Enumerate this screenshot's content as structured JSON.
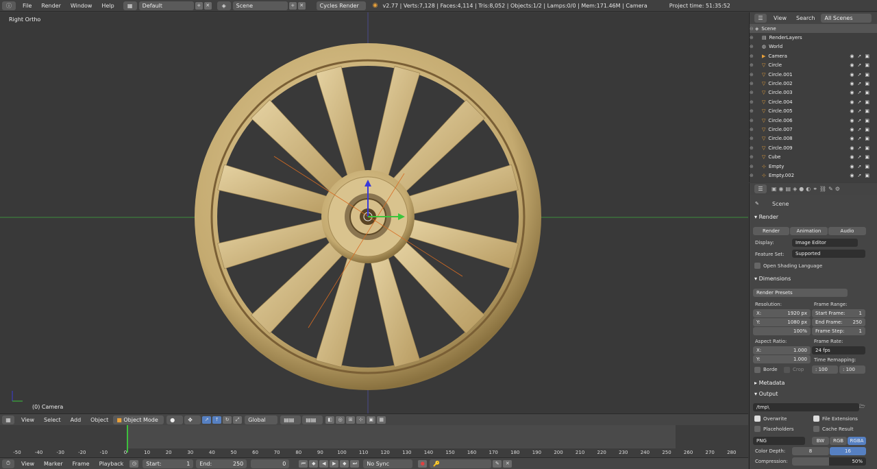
{
  "topbar": {
    "menus": [
      "File",
      "Render",
      "Window",
      "Help"
    ],
    "layout": "Default",
    "scene": "Scene",
    "engine": "Cycles Render",
    "stats": "v2.77 | Verts:7,128 | Faces:4,114 | Tris:8,052 | Objects:1/2 | Lamps:0/0 | Mem:171.46M | Camera",
    "project_time": "Project time: 51:35:52"
  },
  "viewport": {
    "view_name": "Right Ortho",
    "object_label": "(0) Camera"
  },
  "outliner": {
    "menus": [
      "View",
      "Search"
    ],
    "filter": "All Scenes",
    "items": [
      {
        "label": "Scene",
        "icon": "scene-icon",
        "indent": 0
      },
      {
        "label": "RenderLayers",
        "icon": "renderlayers-icon",
        "indent": 1
      },
      {
        "label": "World",
        "icon": "world-icon",
        "indent": 1
      },
      {
        "label": "Camera",
        "icon": "camera-icon",
        "indent": 1
      },
      {
        "label": "Circle",
        "icon": "mesh-icon",
        "indent": 1
      },
      {
        "label": "Circle.001",
        "icon": "mesh-icon",
        "indent": 1
      },
      {
        "label": "Circle.002",
        "icon": "mesh-icon",
        "indent": 1
      },
      {
        "label": "Circle.003",
        "icon": "mesh-icon",
        "indent": 1
      },
      {
        "label": "Circle.004",
        "icon": "mesh-icon",
        "indent": 1
      },
      {
        "label": "Circle.005",
        "icon": "mesh-icon",
        "indent": 1
      },
      {
        "label": "Circle.006",
        "icon": "mesh-icon",
        "indent": 1
      },
      {
        "label": "Circle.007",
        "icon": "mesh-icon",
        "indent": 1
      },
      {
        "label": "Circle.008",
        "icon": "mesh-icon",
        "indent": 1
      },
      {
        "label": "Circle.009",
        "icon": "mesh-icon",
        "indent": 1
      },
      {
        "label": "Cube",
        "icon": "mesh-icon",
        "indent": 1
      },
      {
        "label": "Empty",
        "icon": "empty-icon",
        "indent": 1
      },
      {
        "label": "Empty.002",
        "icon": "empty-icon",
        "indent": 1
      }
    ]
  },
  "props": {
    "context": "Scene",
    "render_panel": "Render",
    "tabs": [
      "Render",
      "Animation",
      "Audio"
    ],
    "display_label": "Display:",
    "display_value": "Image Editor",
    "feature_label": "Feature Set:",
    "feature_value": "Supported",
    "osl_label": "Open Shading Language",
    "dimensions_panel": "Dimensions",
    "render_presets": "Render Presets",
    "resolution_label": "Resolution:",
    "res_x_label": "X:",
    "res_x": "1920 px",
    "res_y_label": "Y:",
    "res_y": "1080 px",
    "res_pct": "100%",
    "frame_range_label": "Frame Range:",
    "start_frame_label": "Start Frame:",
    "start_frame": "1",
    "end_frame_label": "End Frame:",
    "end_frame": "250",
    "frame_step_label": "Frame Step:",
    "frame_step": "1",
    "aspect_label": "Aspect Ratio:",
    "aspect_x_label": "X:",
    "aspect_x": "1.000",
    "aspect_y_label": "Y:",
    "aspect_y": "1.000",
    "frame_rate_label": "Frame Rate:",
    "frame_rate": "24 fps",
    "time_remap_label": "Time Remapping:",
    "remap_old": ": 100",
    "remap_new": ": 100",
    "border_label": "Borde",
    "crop_label": "Crop",
    "metadata_panel": "Metadata",
    "output_panel": "Output",
    "output_path": "/tmp\\",
    "overwrite_label": "Overwrite",
    "file_ext_label": "File Extensions",
    "placeholders_label": "Placeholders",
    "cache_label": "Cache Result",
    "format": "PNG",
    "color_modes": [
      "BW",
      "RGB",
      "RGBA"
    ],
    "color_depth_label": "Color Depth:",
    "depth_8": "8",
    "depth_16": "16",
    "compression_label": "Compression:",
    "compression_value": "50%",
    "compression_fill": 0.5
  },
  "vpheader": {
    "menus": [
      "View",
      "Select",
      "Add",
      "Object"
    ],
    "mode": "Object Mode",
    "orientation": "Global"
  },
  "timeline": {
    "ticks": [
      "-50",
      "-40",
      "-30",
      "-20",
      "-10",
      "0",
      "10",
      "20",
      "30",
      "40",
      "50",
      "60",
      "70",
      "80",
      "90",
      "100",
      "110",
      "120",
      "130",
      "140",
      "150",
      "160",
      "170",
      "180",
      "190",
      "200",
      "210",
      "220",
      "230",
      "240",
      "250",
      "260",
      "270",
      "280"
    ],
    "menus": [
      "View",
      "Marker",
      "Frame",
      "Playback"
    ],
    "start_label": "Start:",
    "start_value": "1",
    "end_label": "End:",
    "end_value": "250",
    "current_frame": "0",
    "sync": "No Sync"
  },
  "colors": {
    "wheel_gold": "#c8b07a",
    "accent_blue": "#5680c2",
    "axis_green": "#3d8f3d"
  }
}
